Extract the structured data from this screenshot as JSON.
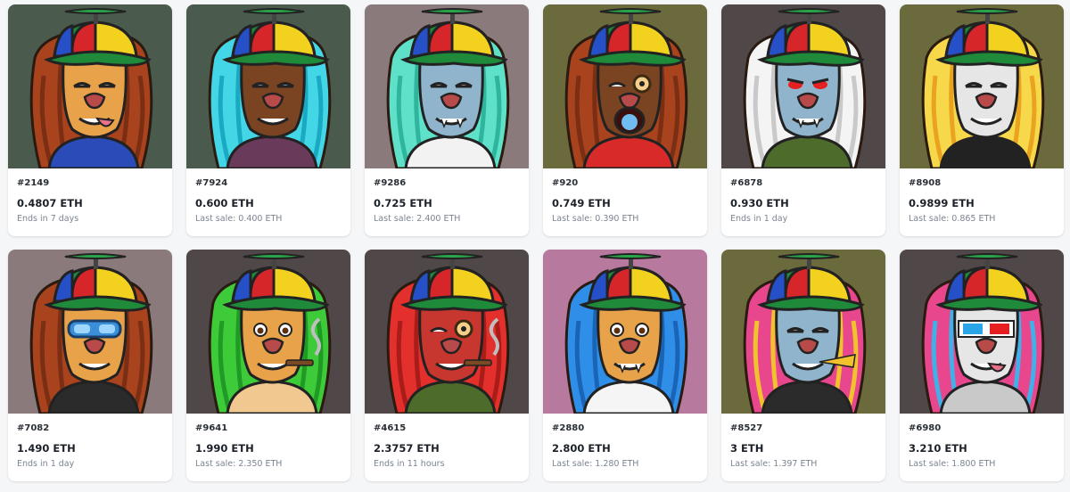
{
  "cards": [
    {
      "id": "#2149",
      "price": "0.4807 ETH",
      "sub": "Ends in 7 days",
      "bg": "#4a5b4d",
      "mane": "#a8431d",
      "mane2": "#7a2e13",
      "face": "#e8a24a",
      "shirt": "#2a4bb8",
      "eyes": "sleepy",
      "extra": "tongue"
    },
    {
      "id": "#7924",
      "price": "0.600 ETH",
      "sub": "Last sale: 0.400 ETH",
      "bg": "#4a5b4d",
      "mane": "#43d6e6",
      "mane2": "#1aa9c2",
      "face": "#7a4322",
      "shirt": "#6a3a5a",
      "eyes": "sleepy",
      "extra": "grin"
    },
    {
      "id": "#9286",
      "price": "0.725 ETH",
      "sub": "Last sale: 2.400 ETH",
      "bg": "#8b7a7c",
      "mane": "#5fe0c8",
      "mane2": "#2fb59e",
      "face": "#8fb4cc",
      "shirt": "#f2f2f2",
      "eyes": "sleepy",
      "extra": "fang"
    },
    {
      "id": "#920",
      "price": "0.749 ETH",
      "sub": "Last sale: 0.390 ETH",
      "bg": "#6b6a3c",
      "mane": "#a8431d",
      "mane2": "#7a2e13",
      "face": "#7a4322",
      "shirt": "#d92a2a",
      "eyes": "monocle",
      "extra": "open"
    },
    {
      "id": "#6878",
      "price": "0.930 ETH",
      "sub": "Ends in 1 day",
      "bg": "#4f4748",
      "mane": "#f4f4f4",
      "mane2": "#c9c9c9",
      "face": "#8fb4cc",
      "shirt": "#4d6b2a",
      "eyes": "red",
      "extra": "fang"
    },
    {
      "id": "#8908",
      "price": "0.9899 ETH",
      "sub": "Last sale: 0.865 ETH",
      "bg": "#6b6a3c",
      "mane": "#f6d84a",
      "mane2": "#e9a31f",
      "face": "#e6e6e6",
      "shirt": "#222222",
      "eyes": "sleepy",
      "extra": "grin"
    },
    {
      "id": "#7082",
      "price": "1.490 ETH",
      "sub": "Ends in 1 day",
      "bg": "#8b7a7c",
      "mane": "#a8431d",
      "mane2": "#7a2e13",
      "face": "#e8a24a",
      "shirt": "#2b2b2b",
      "eyes": "goggles",
      "extra": "grin"
    },
    {
      "id": "#9641",
      "price": "1.990 ETH",
      "sub": "Last sale: 2.350 ETH",
      "bg": "#4f4748",
      "mane": "#3ecb3a",
      "mane2": "#1f9a24",
      "face": "#e8a24a",
      "shirt": "#f0c890",
      "eyes": "open",
      "extra": "cigar"
    },
    {
      "id": "#4615",
      "price": "2.3757 ETH",
      "sub": "Ends in 11 hours",
      "bg": "#4f4748",
      "mane": "#e4302c",
      "mane2": "#a81c1a",
      "face": "#c8372f",
      "shirt": "#4d6b2a",
      "eyes": "monocle",
      "extra": "cigar"
    },
    {
      "id": "#2880",
      "price": "2.800 ETH",
      "sub": "Last sale: 1.280 ETH",
      "bg": "#b77a9e",
      "mane": "#2f8fe8",
      "mane2": "#1a64b8",
      "face": "#e8a24a",
      "shirt": "#f5f5f5",
      "eyes": "open",
      "extra": "fang"
    },
    {
      "id": "#8527",
      "price": "3 ETH",
      "sub": "Last sale: 1.397 ETH",
      "bg": "#6b6a3c",
      "mane": "#e8478e",
      "mane2": "#f2c12e",
      "face": "#8fb4cc",
      "shirt": "#2b2b2b",
      "eyes": "sleepy",
      "extra": "horn"
    },
    {
      "id": "#6980",
      "price": "3.210 ETH",
      "sub": "Last sale: 1.800 ETH",
      "bg": "#4f4748",
      "mane": "#e8478e",
      "mane2": "#3fb0e8",
      "face": "#e6e6e6",
      "shirt": "#c9c9c9",
      "eyes": "3d",
      "extra": "tongue"
    }
  ]
}
